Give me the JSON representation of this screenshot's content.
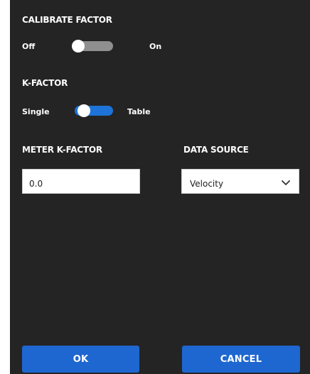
{
  "calibrate_factor": {
    "title": "CALIBRATE FACTOR",
    "off_label": "Off",
    "on_label": "On",
    "state": "off"
  },
  "k_factor": {
    "title": "K-FACTOR",
    "left_label": "Single",
    "right_label": "Table",
    "state": "on"
  },
  "meter_k_factor": {
    "title": "METER K-FACTOR",
    "value": "0.0"
  },
  "data_source": {
    "title": "DATA SOURCE",
    "selected": "Velocity"
  },
  "buttons": {
    "ok": "OK",
    "cancel": "CANCEL"
  },
  "colors": {
    "panel_background": "#242424",
    "toggle_on": "#1e73d8",
    "toggle_off": "#8f8f8f",
    "button_primary": "#1e67d0"
  }
}
